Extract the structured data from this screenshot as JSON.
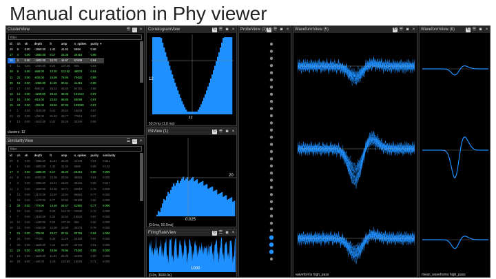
{
  "slide_title": "Manual curation in Phy viewer",
  "cluster_view": {
    "title": "ClusterView",
    "filter_placeholder": "filter",
    "columns": [
      "id",
      "ch",
      "sh",
      "depth",
      "fr",
      "amp",
      "n_spikes",
      "purity ▼"
    ],
    "rows": [
      {
        "cells": [
          "20",
          "5",
          "0.00",
          "-1860.00",
          "1.42",
          "41.63",
          "5868",
          "0.98"
        ],
        "state": "mua"
      },
      {
        "cells": [
          "17",
          "4",
          "0.00",
          "-1880.00",
          "8.17",
          "33.36",
          "29416",
          "0.95"
        ],
        "state": "good"
      },
      {
        "cells": [
          "10",
          "3",
          "0.00",
          "-1900.00",
          "15.75",
          "44.67",
          "67939",
          "0.94"
        ],
        "state": "sel"
      },
      {
        "cells": [
          "9",
          "11",
          "0.00",
          "-1400.00",
          "8.24",
          "107.06",
          "806",
          "0.92"
        ],
        "state": "noise"
      },
      {
        "cells": [
          "28",
          "9",
          "0.00",
          "-880.00",
          "13.30",
          "113.62",
          "48878",
          "0.91"
        ],
        "state": "good"
      },
      {
        "cells": [
          "11",
          "22",
          "0.00",
          "-630.00",
          "19.58",
          "78.94",
          "70482",
          "0.89"
        ],
        "state": "good"
      },
      {
        "cells": [
          "35",
          "18",
          "0.00",
          "-1050.00",
          "11.59",
          "80.61",
          "41415",
          "0.89"
        ],
        "state": "good"
      },
      {
        "cells": [
          "37",
          "17",
          "0.00",
          "-880.00",
          "28.31",
          "48.80",
          "94725",
          "0.88"
        ],
        "state": "noise"
      },
      {
        "cells": [
          "16",
          "14",
          "0.00",
          "-1190.00",
          "28.16",
          "38.36",
          "101413",
          "0.87"
        ],
        "state": "good"
      },
      {
        "cells": [
          "13",
          "16",
          "0.00",
          "-810.00",
          "23.63",
          "68.85",
          "85098",
          "0.87"
        ],
        "state": "good"
      },
      {
        "cells": [
          "15",
          "24",
          "0.00",
          "-490.00",
          "28.62",
          "87.96",
          "103039",
          "0.87"
        ],
        "state": "good"
      },
      {
        "cells": [
          "4",
          "1",
          "0.00",
          "-2100.00",
          "9.41",
          "29.52",
          "18639",
          "0.87"
        ],
        "state": "noise"
      },
      {
        "cells": [
          "23",
          "25",
          "0.00",
          "-430.00",
          "21.53",
          "46.77",
          "77516",
          "0.87"
        ],
        "state": "noise"
      },
      {
        "cells": [
          "9",
          "13",
          "0.00",
          "-1610.00",
          "8.42",
          "25.26",
          "30349",
          "0.85"
        ],
        "state": "noise"
      }
    ],
    "status": "clusters: 12"
  },
  "similarity_view": {
    "title": "SimilarityView",
    "filter_placeholder": "filter",
    "columns": [
      "id",
      "ch",
      "sh",
      "depth",
      "fr",
      "amp",
      "n_spikes",
      "purity",
      "similarity"
    ],
    "rows": [
      {
        "cells": [
          "20",
          "5",
          "0.00",
          "-1860.00",
          "11.51",
          "30.36",
          "41445",
          "0.94",
          "0.821"
        ],
        "state": "noise"
      },
      {
        "cells": [
          "6",
          "1",
          "0.00",
          "-1890.00",
          "1.42",
          "41.63",
          "5868",
          "0.98",
          "0.134"
        ],
        "state": "noise"
      },
      {
        "cells": [
          "17",
          "4",
          "0.00",
          "-1880.00",
          "8.17",
          "33.36",
          "29416",
          "0.95",
          "0.000"
        ],
        "state": "good"
      },
      {
        "cells": [
          "22",
          "8",
          "0.00",
          "-2050.00",
          "10.96",
          "28.56",
          "39504",
          "0.84",
          "0.000"
        ],
        "state": "noise"
      },
      {
        "cells": [
          "8",
          "3",
          "0.00",
          "-1890.00",
          "10.61",
          "16.65",
          "38222",
          "0.66",
          "0.647"
        ],
        "state": "noise"
      },
      {
        "cells": [
          "21",
          "2",
          "0.00",
          "-1920.00",
          "14.35",
          "20.71",
          "60619",
          "0.79",
          "0.610"
        ],
        "state": "noise"
      },
      {
        "cells": [
          "9",
          "13",
          "0.00",
          "-2170.00",
          "24.97",
          "18.91",
          "89684",
          "0.77",
          "0.000"
        ],
        "state": "noise"
      },
      {
        "cells": [
          "1",
          "18",
          "0.00",
          "-1470.00",
          "6.77",
          "22.85",
          "25169",
          "0.82",
          "0.000"
        ],
        "state": "noise"
      },
      {
        "cells": [
          "2",
          "28",
          "0.00",
          "-770.00",
          "14.46",
          "64.67",
          "51982",
          "0.77",
          "0.000"
        ],
        "state": "good"
      },
      {
        "cells": [
          "3",
          "10",
          "0.00",
          "-70.00",
          "6.28",
          "113.72",
          "22535",
          "0.72",
          "0.000"
        ],
        "state": "noise"
      },
      {
        "cells": [
          "5",
          "7",
          "0.00",
          "-2180.00",
          "5.44",
          "26.52",
          "19829",
          "0.87",
          "0.000"
        ],
        "state": "noise"
      },
      {
        "cells": [
          "19",
          "11",
          "0.00",
          "-1460.00",
          "0.24",
          "107.06",
          "859",
          "0.92",
          "0.000"
        ],
        "state": "noise"
      },
      {
        "cells": [
          "16",
          "10",
          "0.00",
          "-1460.00",
          "10.09",
          "29.98",
          "36278",
          "0.78",
          "0.000"
        ],
        "state": "noise"
      },
      {
        "cells": [
          "7",
          "21",
          "0.00",
          "-700.00",
          "23.27",
          "87.94",
          "83794",
          "0.84",
          "0.000"
        ],
        "state": "good"
      },
      {
        "cells": [
          "6",
          "26",
          "0.00",
          "-70.00",
          "9.48",
          "11.25",
          "34169",
          "0.81",
          "0.000"
        ],
        "state": "noise"
      },
      {
        "cells": [
          "4",
          "20",
          "0.00",
          "-1330.00",
          "7.14",
          "52.99",
          "25723",
          "0.81",
          "0.000"
        ],
        "state": "noise"
      },
      {
        "cells": [
          "11",
          "22",
          "0.00",
          "-630.00",
          "19.58",
          "78.94",
          "70482",
          "0.89",
          "0.000"
        ],
        "state": "good"
      },
      {
        "cells": [
          "14",
          "13",
          "0.00",
          "-1240.00",
          "11.64",
          "20.38",
          "41909",
          "0.80",
          "0.000"
        ],
        "state": "noise"
      },
      {
        "cells": [
          "30",
          "29",
          "0.00",
          "-140.00",
          "4.18",
          "122.88",
          "15036",
          "0.71",
          "0.000"
        ],
        "state": "noise"
      }
    ]
  },
  "correlogram_view": {
    "title": "CorrelogramView",
    "y_label": "12",
    "x_label": "12",
    "status": "50.0 ms (1.0 ms)"
  },
  "isi_view": {
    "title": "ISIView (1)",
    "y_label": "20",
    "x_label": "0.025",
    "status": "[0.0ms, 50.0ms]"
  },
  "firing_rate_view": {
    "title": "FiringRateView",
    "x_label": "1000",
    "status": "[0.0s, 3600.0s]"
  },
  "probe_view": {
    "title": "ProbeView (1)",
    "dot_count": 31,
    "highlighted_dots": [
      27,
      28,
      29
    ],
    "dot_color": "#8a8a8a",
    "highlight_color": "#1e90ff"
  },
  "waveform_view": {
    "title": "WaveformView (5)",
    "status": "waveforms high_pass"
  },
  "waveform_view_mean": {
    "title": "WaveformView (6)",
    "status": "mean_waveforms high_pass"
  },
  "colors": {
    "accent": "#1e90ff",
    "good": "#66ff66",
    "panel_bg": "#000000",
    "titlebar": "#262626"
  }
}
